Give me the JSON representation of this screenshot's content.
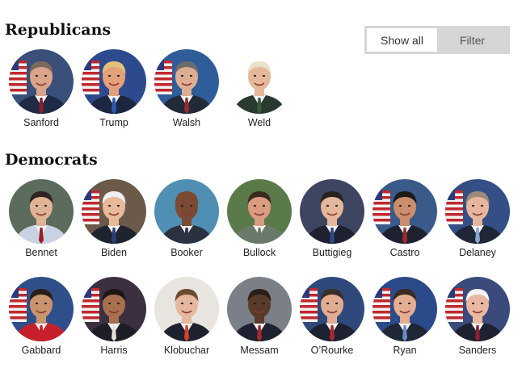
{
  "sections": {
    "republicans": {
      "title": "Republicans",
      "candidates": [
        {
          "name": "Sanford",
          "bg": "#3a4f7a",
          "skin": "#d9a48a",
          "hair": "#7b6a5a",
          "suit": "#1f2a44",
          "tie": "#8a1e2a",
          "flag": true
        },
        {
          "name": "Trump",
          "bg": "#2e4a8e",
          "skin": "#e3a179",
          "hair": "#e2c27a",
          "suit": "#1d2640",
          "tie": "#2a5bb3",
          "flag": true
        },
        {
          "name": "Walsh",
          "bg": "#2f5d9a",
          "skin": "#dcae92",
          "hair": "#6b6b6b",
          "suit": "#222a38",
          "tie": "#9b2a2a",
          "flag": true
        },
        {
          "name": "Weld",
          "bg": "#ffffff",
          "skin": "#e6b89a",
          "hair": "#e8e2c8",
          "suit": "#2a3a30",
          "tie": "#3b5a3a",
          "flag": false,
          "cutout": true
        }
      ]
    },
    "democrats": {
      "title": "Democrats",
      "row1": [
        {
          "name": "Bennet",
          "bg": "#5b6b5c",
          "skin": "#e0b296",
          "hair": "#2e2520",
          "suit": "#c9d2e0",
          "tie": "#9a1f2a",
          "flag": false
        },
        {
          "name": "Biden",
          "bg": "#6b5a4a",
          "skin": "#e8b99a",
          "hair": "#f0f0f0",
          "suit": "#1e2330",
          "tie": "#2a3f7a",
          "flag": true
        },
        {
          "name": "Booker",
          "bg": "#4f8fb3",
          "skin": "#7a4a32",
          "hair": "#7a4a32",
          "suit": "#2a3240",
          "tie": "#2a3240",
          "flag": false
        },
        {
          "name": "Bullock",
          "bg": "#5a7a4a",
          "skin": "#d99c80",
          "hair": "#3a2a20",
          "suit": "#6a7a6a",
          "tie": "#6a7a6a",
          "flag": false
        },
        {
          "name": "Buttigieg",
          "bg": "#3e4560",
          "skin": "#e4b79c",
          "hair": "#2a2220",
          "suit": "#1e2230",
          "tie": "#2a4a8a",
          "flag": false
        },
        {
          "name": "Castro",
          "bg": "#3a5a8a",
          "skin": "#c98e6c",
          "hair": "#1e1a18",
          "suit": "#1e2230",
          "tie": "#a02a2a",
          "flag": true
        },
        {
          "name": "Delaney",
          "bg": "#344f86",
          "skin": "#e6b79e",
          "hair": "#9a8a7a",
          "suit": "#1f2636",
          "tie": "#8aa6d0",
          "flag": true
        }
      ],
      "row2": [
        {
          "name": "Gabbard",
          "bg": "#2f4f8a",
          "skin": "#c9946e",
          "hair": "#2a1e18",
          "suit": "#c8202a",
          "tie": "#c8202a",
          "flag": true
        },
        {
          "name": "Harris",
          "bg": "#3a3040",
          "skin": "#a8704e",
          "hair": "#1e1612",
          "suit": "#1e1e26",
          "tie": "#e8e0d8",
          "flag": true
        },
        {
          "name": "Klobuchar",
          "bg": "#e8e4e0",
          "skin": "#e6b79e",
          "hair": "#6a4a30",
          "suit": "#1e2230",
          "tie": "#d8402a",
          "flag": false
        },
        {
          "name": "Messam",
          "bg": "#7a7f88",
          "skin": "#5a3a28",
          "hair": "#2a1e18",
          "suit": "#1e2230",
          "tie": "#a82a2a",
          "flag": false
        },
        {
          "name": "O’Rourke",
          "bg": "#2f4a7a",
          "skin": "#e0ad92",
          "hair": "#3a2e28",
          "suit": "#1e2230",
          "tie": "#a82a2a",
          "flag": true
        },
        {
          "name": "Ryan",
          "bg": "#2a4a8a",
          "skin": "#e3ae92",
          "hair": "#3a2a20",
          "suit": "#1f2636",
          "tie": "#6a8ac0",
          "flag": true
        },
        {
          "name": "Sanders",
          "bg": "#3a4a7a",
          "skin": "#e8b8a0",
          "hair": "#f2f2f2",
          "suit": "#1e2230",
          "tie": "#8a2030",
          "flag": true
        }
      ]
    }
  },
  "filter_toggle": {
    "show_all_label": "Show all",
    "filter_label": "Filter",
    "selected": "Show all"
  }
}
